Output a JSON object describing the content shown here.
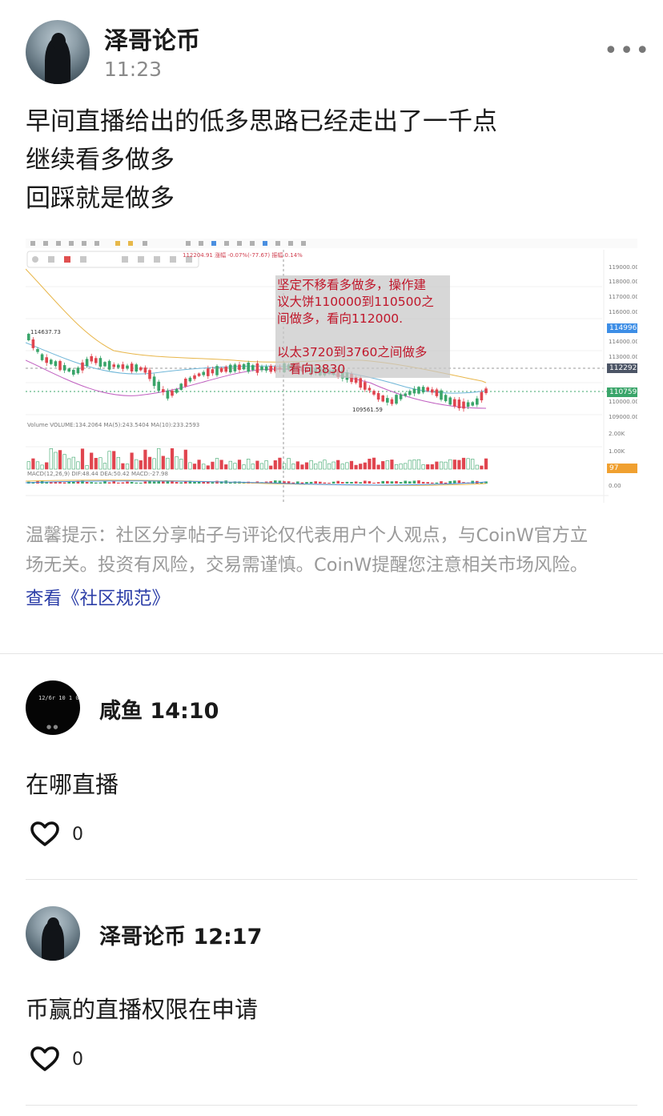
{
  "post": {
    "author": "泽哥论币",
    "time": "11:23",
    "lines": [
      "早间直播给出的低多思路已经走出了一千点",
      "继续看多做多",
      "回踩就是做多"
    ],
    "more_icon": "more-horizontal-icon"
  },
  "chart_image": {
    "annotation_lines": [
      "坚定不移看多做多，操作建",
      "议大饼110000到110500之",
      "间做多，看向112000.",
      "",
      "以太3720到3760之间做多",
      "   看向3830"
    ],
    "price_labels": {
      "current_cross": "112292.40",
      "blue_tag": "114996.95",
      "green_tag": "110759.99",
      "orange_tag": "97",
      "high_marker": "114637.73",
      "low_marker": "109561.59"
    },
    "y_ticks": [
      "119000.00",
      "118000.00",
      "117000.00",
      "116000.00",
      "114000.00",
      "113000.00",
      "110000.00",
      "109000.00",
      "2.00K",
      "1.00K",
      "0.00"
    ],
    "indicator_labels": {
      "volume": "Volume  VOLUME:134.2064  MA(5):243.5404  MA(10):233.2593",
      "macd": "MACD(12,26,9)  DIF:48.44  DEA:50.42  MACD:-27.98",
      "header_ohlc": "112204.91  涨幅 -0.07%(-77.67)  振幅 0.14%"
    },
    "colors": {
      "up": "#3aa56a",
      "down": "#e0454f",
      "annotation_text": "#c0162a"
    }
  },
  "disclaimer": {
    "text_line1": "温馨提示：社区分享帖子与评论仅代表用户个人观点，与CoinW官方立",
    "text_line2": "场无关。投资有风险，交易需谨慎。CoinW提醒您注意相关市场风险。",
    "link": "查看《社区规范》"
  },
  "comments": [
    {
      "name": "咸鱼",
      "time": "14:10",
      "text": "在哪直播",
      "likes": "0",
      "avatar_text": "12/6r 10 1 0 2 3"
    },
    {
      "name": "泽哥论币",
      "time": "12:17",
      "text": "币赢的直播权限在申请",
      "likes": "0"
    }
  ],
  "icons": {
    "like": "heart-outline-icon"
  }
}
